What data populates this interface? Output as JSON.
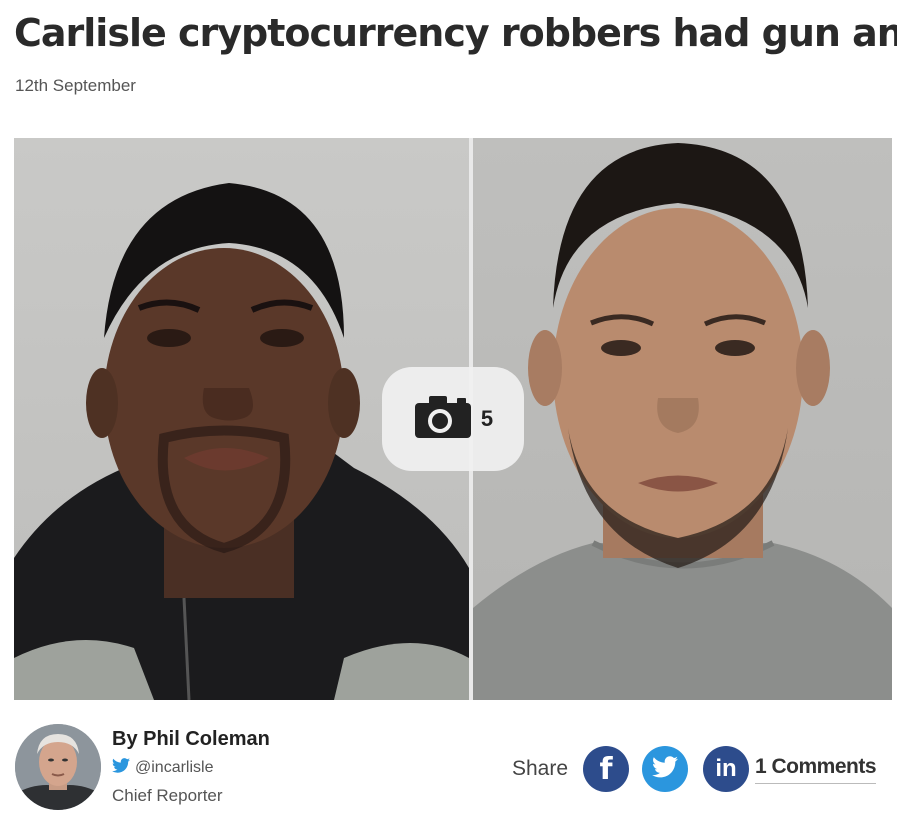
{
  "article": {
    "headline": "Carlisle cryptocurrency robbers had gun and",
    "date": "12th September"
  },
  "hero": {
    "photo_left": "mugshot-photo",
    "photo_right": "mugshot-photo",
    "gallery_icon": "camera-icon",
    "gallery_count": "5"
  },
  "author": {
    "name": "By Phil Coleman",
    "handle": "@incarlisle",
    "handle_icon": "twitter-icon",
    "role": "Chief Reporter"
  },
  "share": {
    "label": "Share",
    "buttons": [
      {
        "icon": "facebook-icon",
        "color": "#2d4c8c"
      },
      {
        "icon": "twitter-icon",
        "color": "#2b96de"
      },
      {
        "icon": "linkedin-icon",
        "color": "#2d4c8c"
      }
    ],
    "comments_label": "1 Comments"
  }
}
